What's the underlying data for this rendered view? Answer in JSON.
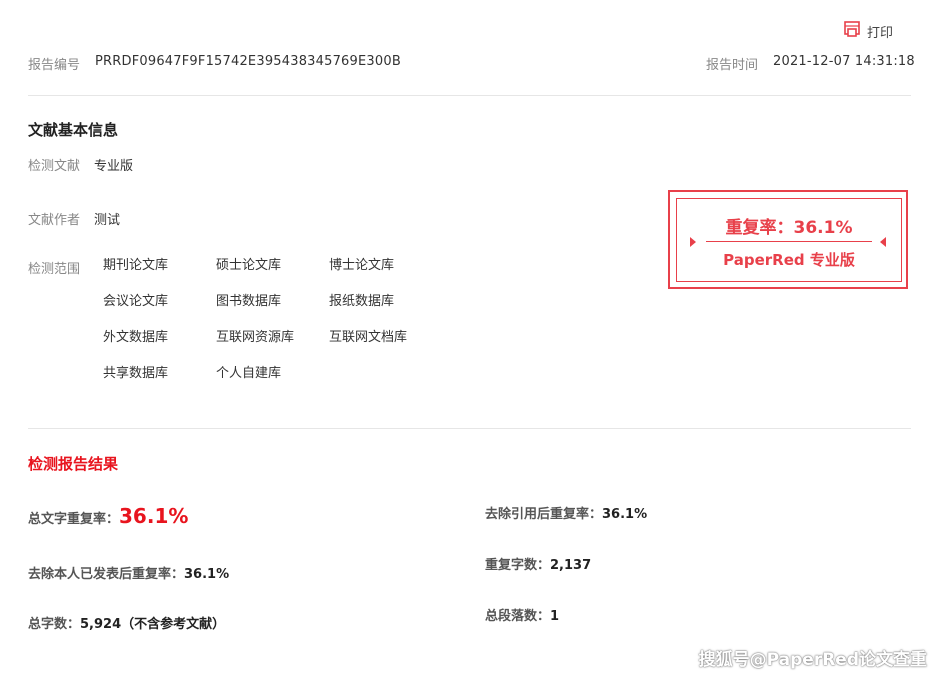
{
  "toolbar": {
    "print_label": "打印"
  },
  "report": {
    "id_label": "报告编号",
    "id_value": "PRRDF09647F9F15742E395438345769E300B",
    "time_label": "报告时间",
    "time_value": "2021-12-07 14:31:18"
  },
  "basic_info": {
    "title": "文献基本信息",
    "doc_label": "检测文献",
    "doc_value": "专业版",
    "author_label": "文献作者",
    "author_value": "测试",
    "scope_label": "检测范围",
    "libraries": [
      "期刊论文库",
      "硕士论文库",
      "博士论文库",
      "会议论文库",
      "图书数据库",
      "报纸数据库",
      "外文数据库",
      "互联网资源库",
      "互联网文档库",
      "共享数据库",
      "个人自建库"
    ]
  },
  "stamp": {
    "rate_text": "重复率：36.1%",
    "edition": "PaperRed 专业版",
    "color": "#e8404a"
  },
  "results": {
    "title": "检测报告结果",
    "total_rate_label": "总文字重复率：",
    "total_rate_value": "36.1%",
    "excl_self_label": "去除本人已发表后重复率：",
    "excl_self_value": "36.1%",
    "total_chars_label": "总字数：",
    "total_chars_value": "5,924（不含参考文献）",
    "excl_cite_label": "去除引用后重复率：",
    "excl_cite_value": "36.1%",
    "dup_chars_label": "重复字数：",
    "dup_chars_value": "2,137",
    "paragraphs_label": "总段落数：",
    "paragraphs_value": "1"
  },
  "watermark": "搜狐号@PaperRed论文查重",
  "accent_color": "#e8141e"
}
